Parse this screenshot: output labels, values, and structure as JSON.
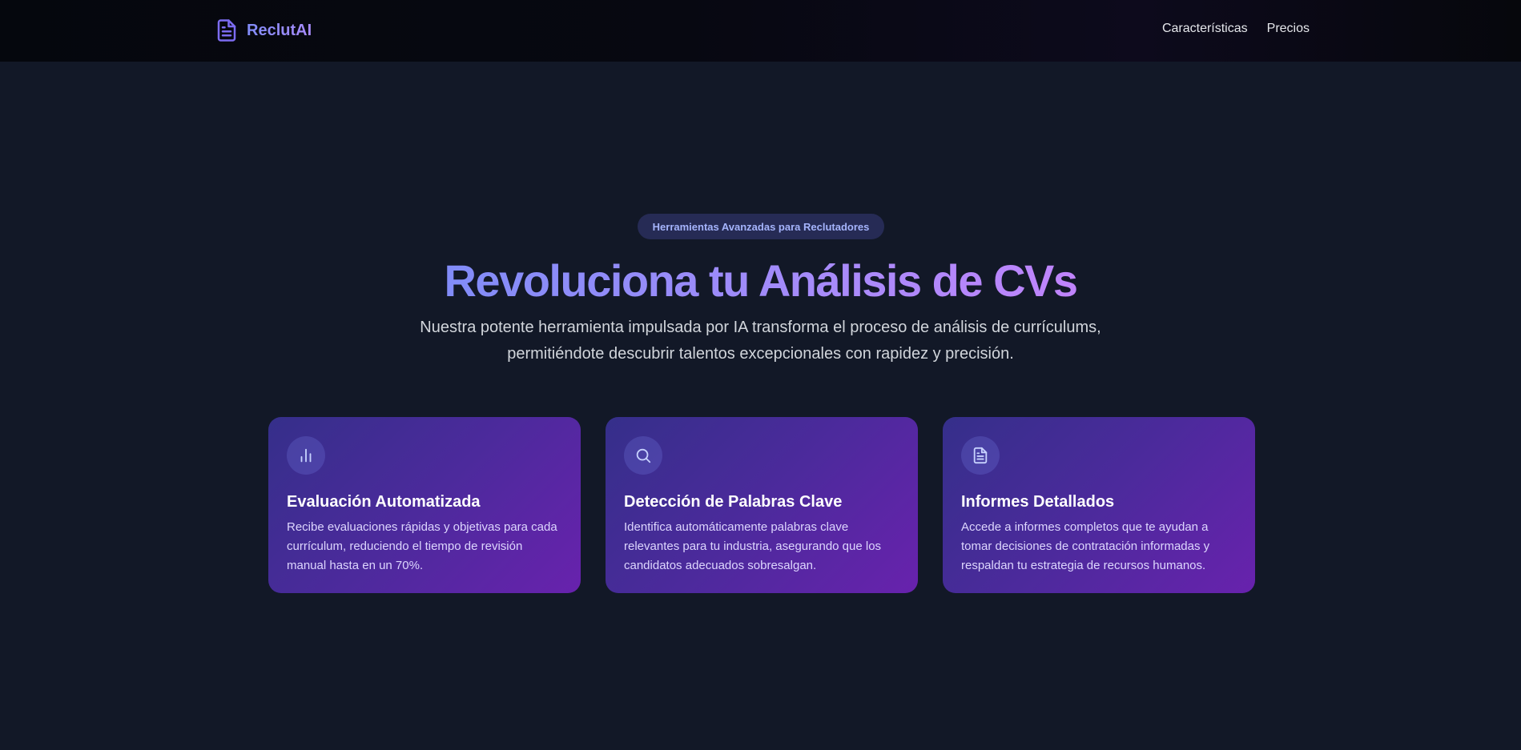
{
  "nav": {
    "brand": "ReclutAI",
    "links": [
      "Características",
      "Precios"
    ]
  },
  "hero": {
    "badge": "Herramientas Avanzadas para Reclutadores",
    "title": "Revoluciona tu Análisis de CVs",
    "subtitle_line1": "Nuestra potente herramienta impulsada por IA transforma el proceso de análisis de currículums,",
    "subtitle_line2": "permitiéndote descubrir talentos excepcionales con rapidez y precisión."
  },
  "features": [
    {
      "icon": "bar-chart-icon",
      "title": "Evaluación Automatizada",
      "text": "Recibe evaluaciones rápidas y objetivas para cada currículum, reduciendo el tiempo de revisión manual hasta en un 70%."
    },
    {
      "icon": "search-icon",
      "title": "Detección de Palabras Clave",
      "text": "Identifica automáticamente palabras clave relevantes para tu industria, asegurando que los candidatos adecuados sobresalgan."
    },
    {
      "icon": "document-icon",
      "title": "Informes Detallados",
      "text": "Accede a informes completos que te ayudan a tomar decisiones de contratación informadas y respaldan tu estrategia de recursos humanos."
    }
  ],
  "colors": {
    "background": "#121827",
    "accent": "#818cf8",
    "accent_purple": "#a78bfa"
  }
}
